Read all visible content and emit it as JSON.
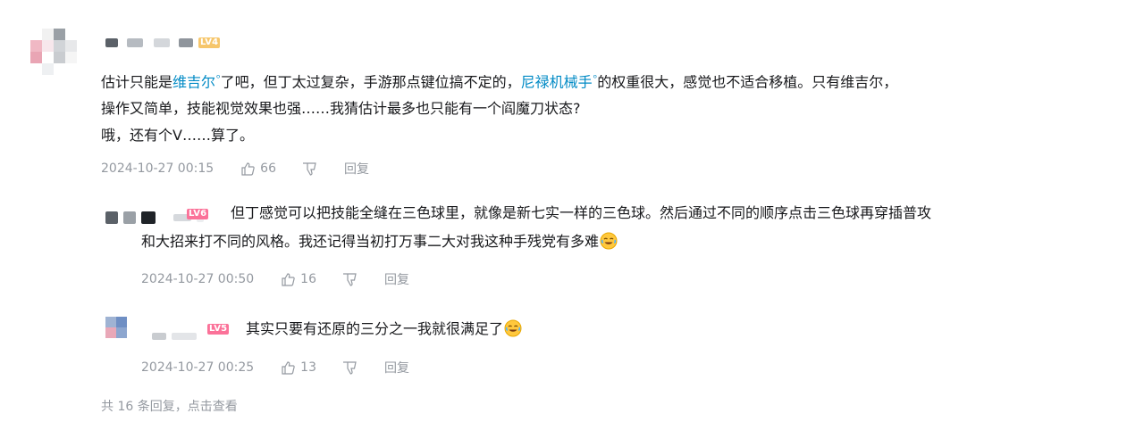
{
  "colors": {
    "link": "#008ac5",
    "meta": "#9499a0",
    "text": "#18191c",
    "level_badge": "#fb7299",
    "level_badge_main": "#f6c66b"
  },
  "main_comment": {
    "level_badge": "LV4",
    "text_part1": "估计只能是",
    "link1": "维吉尔",
    "text_part2": "了吧，但丁太过复杂，手游那点键位搞不定的，",
    "link2": "尼禄机械手",
    "text_part3": "的权重很大，感觉也不适合移植。只有维吉尔，",
    "line2": "操作又简单，技能视觉效果也强……我猜估计最多也只能有一个阎魔刀状态?",
    "line3": "哦，还有个V……算了。",
    "time": "2024-10-27 00:15",
    "likes": "66",
    "reply_label": "回复",
    "link_icon": "search-icon"
  },
  "replies": [
    {
      "level_badge": "LV6",
      "text_line1": "但丁感觉可以把技能全缝在三色球里，就像是新七实一样的三色球。然后通过不同的顺序点击三色球再穿插普攻",
      "text_line2": "和大招来打不同的风格。我还记得当初打万事二大对我这种手残党有多难",
      "emoji": "laugh-cry-emoji",
      "time": "2024-10-27 00:50",
      "likes": "16",
      "reply_label": "回复"
    },
    {
      "level_badge": "LV5",
      "text_line1": "其实只要有还原的三分之一我就很满足了",
      "emoji": "laugh-cry-emoji",
      "time": "2024-10-27 00:25",
      "likes": "13",
      "reply_label": "回复"
    }
  ],
  "more_replies": "共 16 条回复，点击查看"
}
